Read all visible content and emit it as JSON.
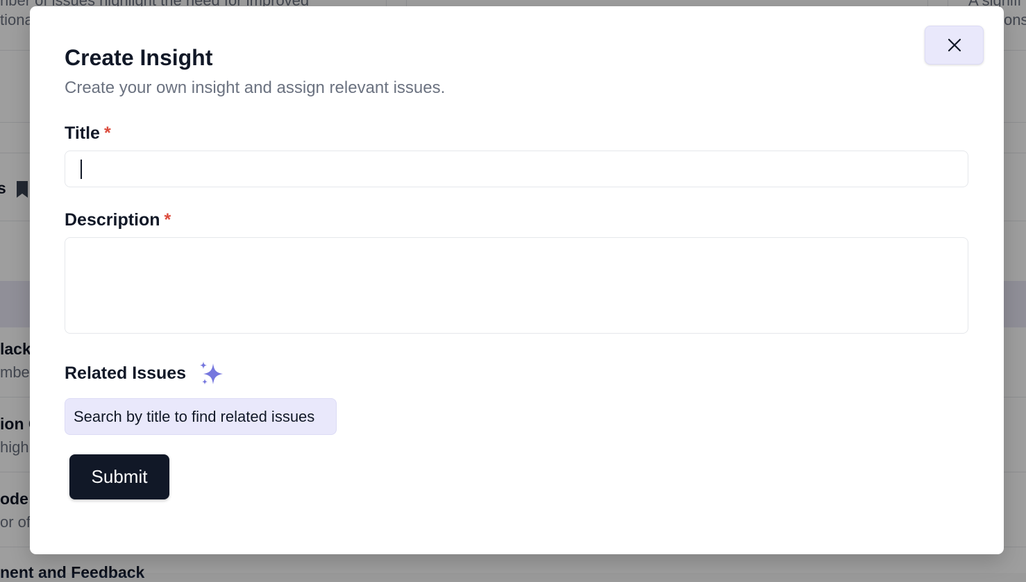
{
  "background": {
    "snippets": [
      "nber of issues highlight the need for improved",
      "tiona",
      "A signifi",
      "onse",
      "s",
      "lack",
      "mbe",
      "ion C",
      "high",
      "ode",
      "or of",
      "nent and Feedback"
    ]
  },
  "modal": {
    "title": "Create Insight",
    "subtitle": "Create your own insight and assign relevant issues.",
    "close_icon": "close-icon",
    "title_label": "Title",
    "description_label": "Description",
    "required_mark": "*",
    "title_value": "",
    "description_value": "",
    "related_issues_label": "Related Issues",
    "related_icon": "sparkle-icon",
    "search_label": "Search by title to find related issues",
    "submit_label": "Submit"
  },
  "colors": {
    "accent_light": "#e9e8fb",
    "sparkle": "#6b6ed8",
    "required": "#dc4b3c",
    "primary_button": "#111827"
  }
}
